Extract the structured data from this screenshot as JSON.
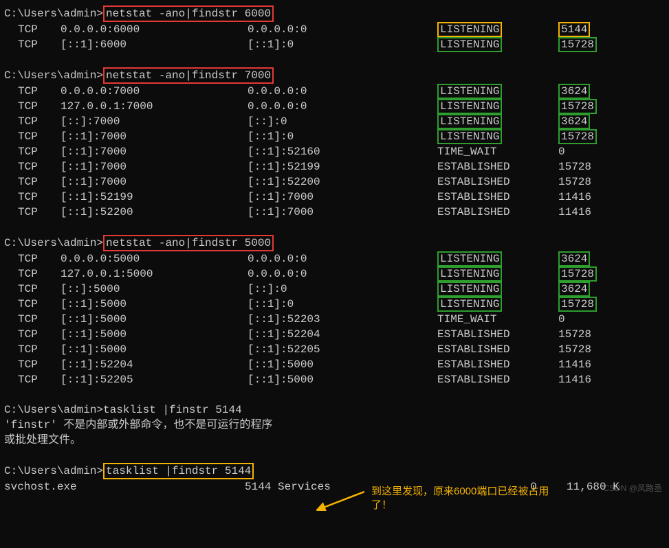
{
  "prompt": "C:\\Users\\admin>",
  "commands": {
    "c1": "netstat -ano|findstr 6000",
    "c2": "netstat -ano|findstr 7000",
    "c3": "netstat -ano|findstr 5000",
    "c4_bad": "tasklist |finstr 5144",
    "c4_err1": "'finstr' 不是内部或外部命令，也不是可运行的程序",
    "c4_err2": "或批处理文件。",
    "c5": "tasklist |findstr 5144"
  },
  "block1": [
    {
      "proto": "TCP",
      "local": "0.0.0.0:6000",
      "remote": "0.0.0.0:0",
      "state": "LISTENING",
      "pid": "5144",
      "stateStyle": "yellow",
      "pidStyle": "yellow"
    },
    {
      "proto": "TCP",
      "local": "[::1]:6000",
      "remote": "[::1]:0",
      "state": "LISTENING",
      "pid": "15728",
      "stateStyle": "green",
      "pidStyle": "green"
    }
  ],
  "block2": [
    {
      "proto": "TCP",
      "local": "0.0.0.0:7000",
      "remote": "0.0.0.0:0",
      "state": "LISTENING",
      "pid": "3624",
      "stateStyle": "green",
      "pidStyle": "green"
    },
    {
      "proto": "TCP",
      "local": "127.0.0.1:7000",
      "remote": "0.0.0.0:0",
      "state": "LISTENING",
      "pid": "15728",
      "stateStyle": "green",
      "pidStyle": "green"
    },
    {
      "proto": "TCP",
      "local": "[::]:7000",
      "remote": "[::]:0",
      "state": "LISTENING",
      "pid": "3624",
      "stateStyle": "green",
      "pidStyle": "green"
    },
    {
      "proto": "TCP",
      "local": "[::1]:7000",
      "remote": "[::1]:0",
      "state": "LISTENING",
      "pid": "15728",
      "stateStyle": "green",
      "pidStyle": "green"
    },
    {
      "proto": "TCP",
      "local": "[::1]:7000",
      "remote": "[::1]:52160",
      "state": "TIME_WAIT",
      "pid": "0"
    },
    {
      "proto": "TCP",
      "local": "[::1]:7000",
      "remote": "[::1]:52199",
      "state": "ESTABLISHED",
      "pid": "15728"
    },
    {
      "proto": "TCP",
      "local": "[::1]:7000",
      "remote": "[::1]:52200",
      "state": "ESTABLISHED",
      "pid": "15728"
    },
    {
      "proto": "TCP",
      "local": "[::1]:52199",
      "remote": "[::1]:7000",
      "state": "ESTABLISHED",
      "pid": "11416"
    },
    {
      "proto": "TCP",
      "local": "[::1]:52200",
      "remote": "[::1]:7000",
      "state": "ESTABLISHED",
      "pid": "11416"
    }
  ],
  "block3": [
    {
      "proto": "TCP",
      "local": "0.0.0.0:5000",
      "remote": "0.0.0.0:0",
      "state": "LISTENING",
      "pid": "3624",
      "stateStyle": "green",
      "pidStyle": "green"
    },
    {
      "proto": "TCP",
      "local": "127.0.0.1:5000",
      "remote": "0.0.0.0:0",
      "state": "LISTENING",
      "pid": "15728",
      "stateStyle": "green",
      "pidStyle": "green"
    },
    {
      "proto": "TCP",
      "local": "[::]:5000",
      "remote": "[::]:0",
      "state": "LISTENING",
      "pid": "3624",
      "stateStyle": "green",
      "pidStyle": "green"
    },
    {
      "proto": "TCP",
      "local": "[::1]:5000",
      "remote": "[::1]:0",
      "state": "LISTENING",
      "pid": "15728",
      "stateStyle": "green",
      "pidStyle": "green"
    },
    {
      "proto": "TCP",
      "local": "[::1]:5000",
      "remote": "[::1]:52203",
      "state": "TIME_WAIT",
      "pid": "0"
    },
    {
      "proto": "TCP",
      "local": "[::1]:5000",
      "remote": "[::1]:52204",
      "state": "ESTABLISHED",
      "pid": "15728"
    },
    {
      "proto": "TCP",
      "local": "[::1]:5000",
      "remote": "[::1]:52205",
      "state": "ESTABLISHED",
      "pid": "15728"
    },
    {
      "proto": "TCP",
      "local": "[::1]:52204",
      "remote": "[::1]:5000",
      "state": "ESTABLISHED",
      "pid": "11416"
    },
    {
      "proto": "TCP",
      "local": "[::1]:52205",
      "remote": "[::1]:5000",
      "state": "ESTABLISHED",
      "pid": "11416"
    }
  ],
  "tasklist_result": {
    "name": "svchost.exe",
    "pid": "5144",
    "session_name": "Services",
    "session_num": "0",
    "mem": "11,680 K"
  },
  "annotation": "到这里发现，原来6000端口已经被占用\n了！",
  "watermark": "CSDN @风路丞"
}
